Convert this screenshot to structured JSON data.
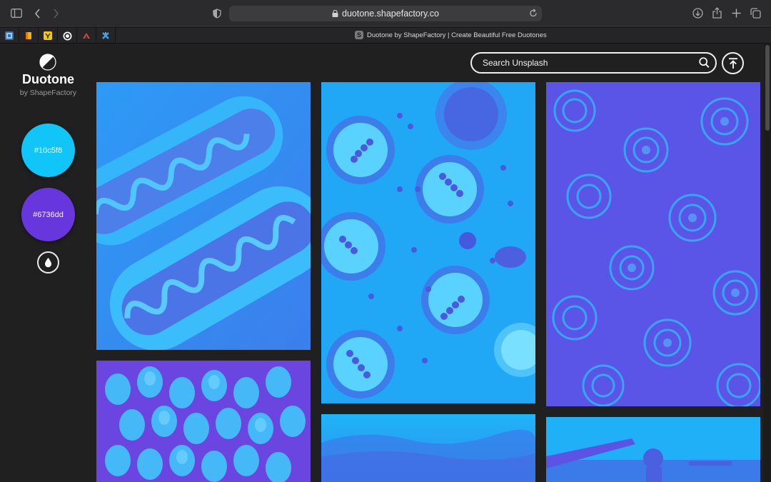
{
  "browser": {
    "url": "duotone.shapefactory.co",
    "tab_title": "Duotone by ShapeFactory | Create Beautiful Free Duotones",
    "tab_favicon_letter": "S",
    "pinned_tabs": [
      "pinned-tab-1",
      "pinned-tab-2",
      "pinned-tab-3",
      "pinned-tab-4",
      "pinned-tab-5",
      "pinned-tab-6"
    ]
  },
  "app": {
    "brand": "Duotone",
    "brand_sub": "by ShapeFactory",
    "highlight_color": "#10c5f8",
    "shadow_color": "#6736dd",
    "highlight_label": "#10c5f8",
    "shadow_label": "#6736dd"
  },
  "search": {
    "placeholder": "Search Unsplash",
    "value": ""
  },
  "gallery": {
    "photos": [
      {
        "name": "photo-hotdogs",
        "subject": "hot dogs"
      },
      {
        "name": "photo-tarts",
        "subject": "cherry tarts"
      },
      {
        "name": "photo-succulents",
        "subject": "succulents"
      },
      {
        "name": "photo-tulips",
        "subject": "tulips"
      },
      {
        "name": "photo-sky",
        "subject": "sky"
      },
      {
        "name": "photo-airplane",
        "subject": "airplane"
      }
    ]
  },
  "icons": {
    "sidebar_toggle": "sidebar-icon",
    "back": "chevron-left-icon",
    "forward": "chevron-right-icon",
    "privacy": "shield-icon",
    "lock": "lock-icon",
    "reload": "reload-icon",
    "download": "download-icon",
    "share": "share-icon",
    "new_tab": "plus-icon",
    "tab_overview": "tabs-icon",
    "logo": "duotone-logo-icon",
    "drop": "drop-icon",
    "search": "search-icon",
    "scroll_top": "arrow-up-icon"
  }
}
